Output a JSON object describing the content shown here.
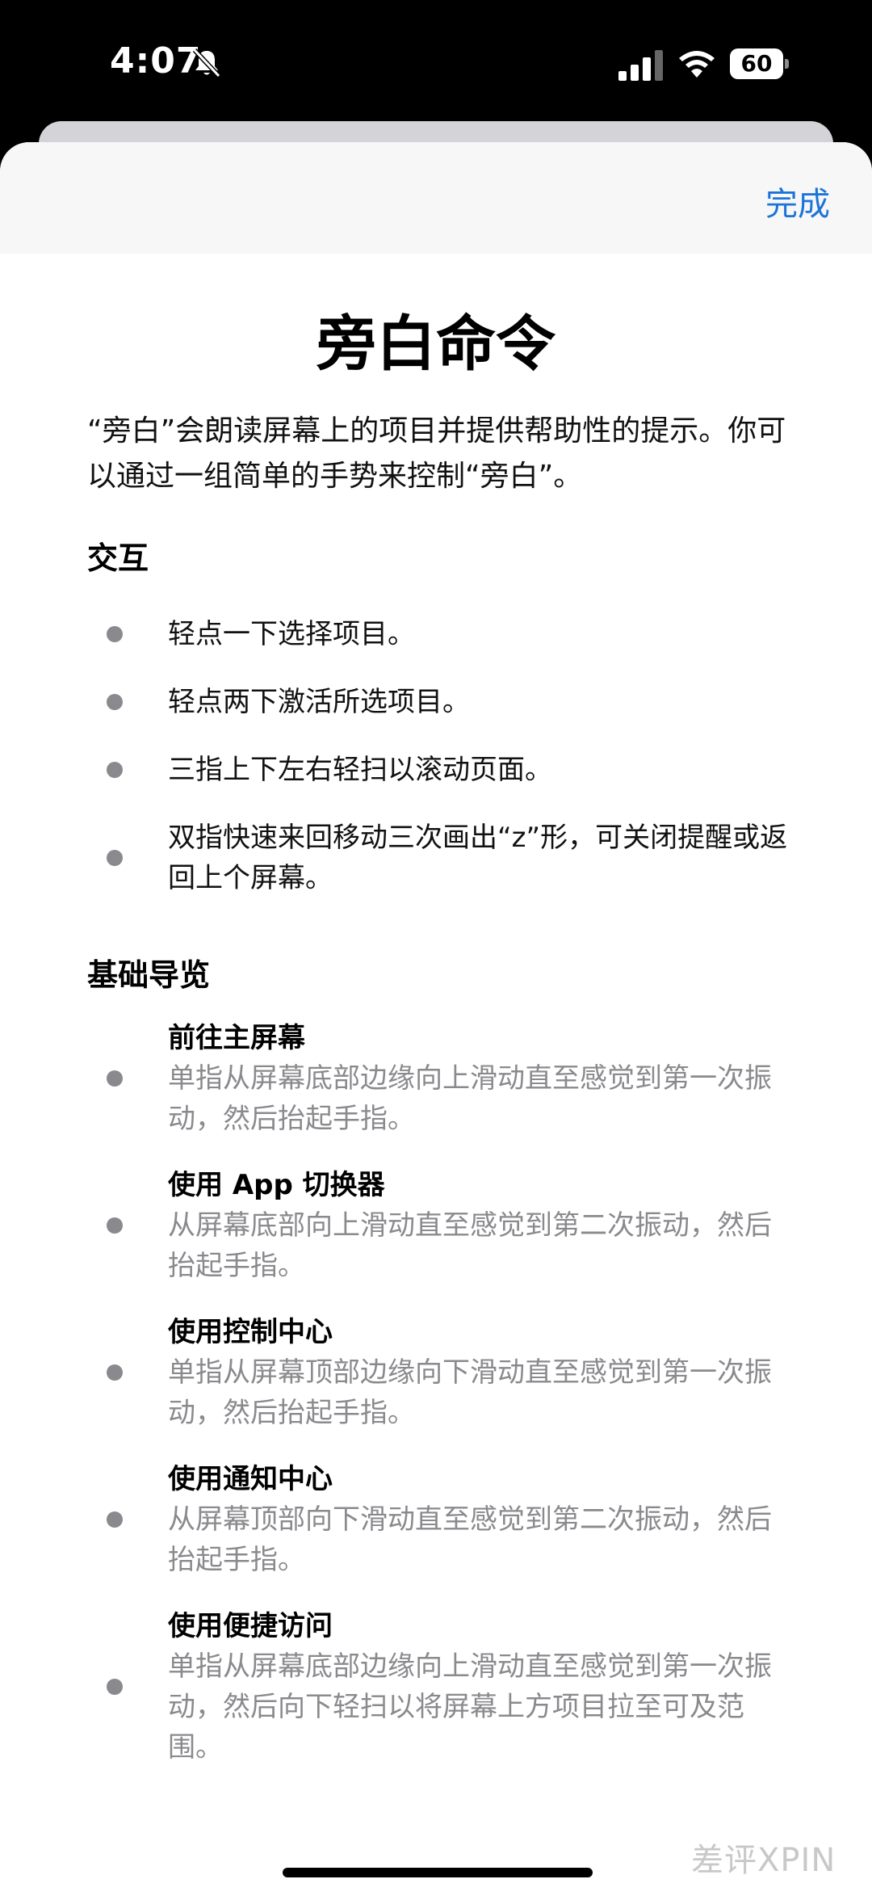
{
  "status_bar": {
    "time": "4:07",
    "battery": "60",
    "icons": [
      "bell-slash-icon",
      "cellular-signal-icon",
      "wifi-icon",
      "battery-icon"
    ]
  },
  "header": {
    "done_label": "完成",
    "accent_color": "#1d74d8"
  },
  "title": "旁白命令",
  "intro": "“旁白”会朗读屏幕上的项目并提供帮助性的提示。你可以通过一组简单的手势来控制“旁白”。",
  "sections": {
    "interaction": {
      "heading": "交互",
      "items": [
        "轻点一下选择项目。",
        "轻点两下激活所选项目。",
        "三指上下左右轻扫以滚动页面。",
        "双指快速来回移动三次画出“z”形，可关闭提醒或返回上个屏幕。"
      ]
    },
    "navigation": {
      "heading": "基础导览",
      "items": [
        {
          "title": "前往主屏幕",
          "desc": "单指从屏幕底部边缘向上滑动直至感觉到第一次振动，然后抬起手指。"
        },
        {
          "title": "使用 App 切换器",
          "desc": "从屏幕底部向上滑动直至感觉到第二次振动，然后抬起手指。"
        },
        {
          "title": "使用控制中心",
          "desc": "单指从屏幕顶部边缘向下滑动直至感觉到第一次振动，然后抬起手指。"
        },
        {
          "title": "使用通知中心",
          "desc": "从屏幕顶部向下滑动直至感觉到第二次振动，然后抬起手指。"
        },
        {
          "title": "使用便捷访问",
          "desc": "单指从屏幕底部边缘向上滑动直至感觉到第一次振动，然后向下轻扫以将屏幕上方项目拉至可及范围。"
        }
      ]
    }
  },
  "watermark": "差评XPIN"
}
